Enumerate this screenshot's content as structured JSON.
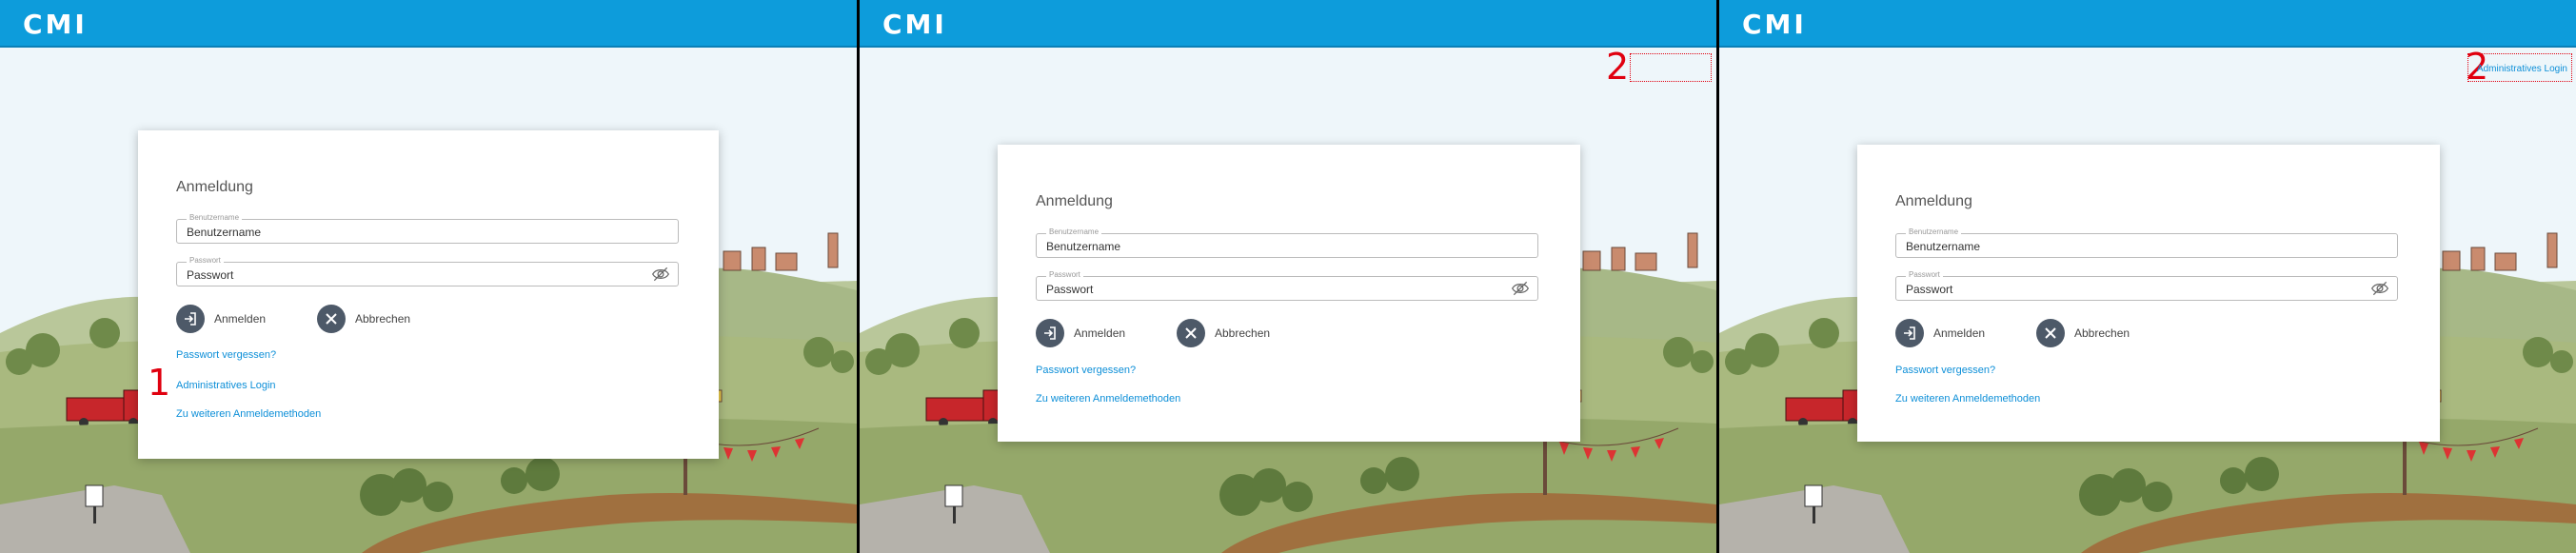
{
  "app": {
    "logo": "CMI"
  },
  "colors": {
    "header": "#0d9cdb",
    "link": "#0d8fd8",
    "button": "#4d5968",
    "annotation": "#e0000f"
  },
  "login": {
    "title": "Anmeldung",
    "username": {
      "label": "Benutzername",
      "value": "Benutzername"
    },
    "password": {
      "label": "Passwort",
      "value": "Passwort"
    },
    "login_button": "Anmelden",
    "cancel_button": "Abbrechen",
    "forgot_link": "Passwort vergessen?",
    "admin_link": "Administratives Login",
    "more_link": "Zu weiteren Anmeldemethoden"
  },
  "steps": {
    "one": "1",
    "two": "2"
  },
  "top_admin_link": "Administratives Login",
  "icons": {
    "login": "login-arrow-icon",
    "cancel": "close-icon",
    "password": "eye-slash-icon"
  }
}
